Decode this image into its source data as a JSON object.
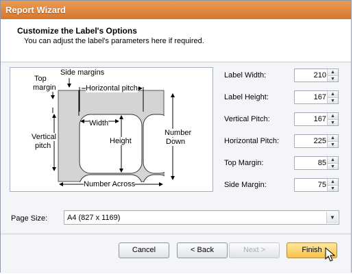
{
  "window": {
    "title": "Report Wizard"
  },
  "header": {
    "title": "Customize the Label's Options",
    "subtitle": "You can adjust the label's parameters here if required."
  },
  "diagram": {
    "top_margin": [
      "Top",
      "margin"
    ],
    "side_margins": "Side margins",
    "horizontal_pitch": "Horizontal pitch",
    "width": "Width",
    "height": "Height",
    "vertical_pitch": [
      "Vertical",
      "pitch"
    ],
    "number_down": [
      "Number",
      "Down"
    ],
    "number_across": "Number Across"
  },
  "fields": [
    {
      "label": "Label Width:",
      "value": "210"
    },
    {
      "label": "Label Height:",
      "value": "167"
    },
    {
      "label": "Vertical Pitch:",
      "value": "167"
    },
    {
      "label": "Horizontal Pitch:",
      "value": "225"
    },
    {
      "label": "Top Margin:",
      "value": "85"
    },
    {
      "label": "Side Margin:",
      "value": "75"
    }
  ],
  "page_size": {
    "label": "Page Size:",
    "value": "A4 (827 x 1169)"
  },
  "buttons": {
    "cancel": "Cancel",
    "back": "< Back",
    "next": "Next >",
    "finish": "Finish"
  },
  "colors": {
    "title_bar": "#d8772f",
    "finish_button": "#f7c24a"
  }
}
